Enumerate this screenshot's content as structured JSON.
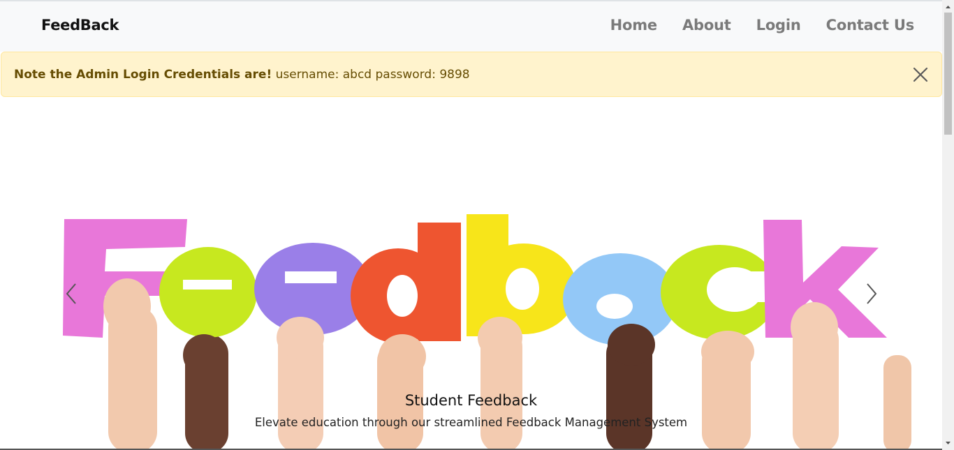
{
  "navbar": {
    "brand": "FeedBack",
    "links": [
      "Home",
      "About",
      "Login",
      "Contact Us"
    ]
  },
  "alert": {
    "strong": "Note the Admin Login Credentials are!",
    "text": " username: abcd password: 9898"
  },
  "carousel": {
    "image_text": "Feedback",
    "caption_title": "Student Feedback",
    "caption_text": "Elevate education through our streamlined Feedback Management System"
  },
  "colors": {
    "navbar_bg": "#f8f9fa",
    "alert_bg": "#fff3cd",
    "alert_text": "#664d03",
    "letter_pink": "#e877d9",
    "letter_lime": "#c7e81f",
    "letter_purple": "#9a7fe8",
    "letter_red": "#ee5530",
    "letter_yellow": "#f7e51a",
    "letter_blue": "#93c8f7"
  }
}
